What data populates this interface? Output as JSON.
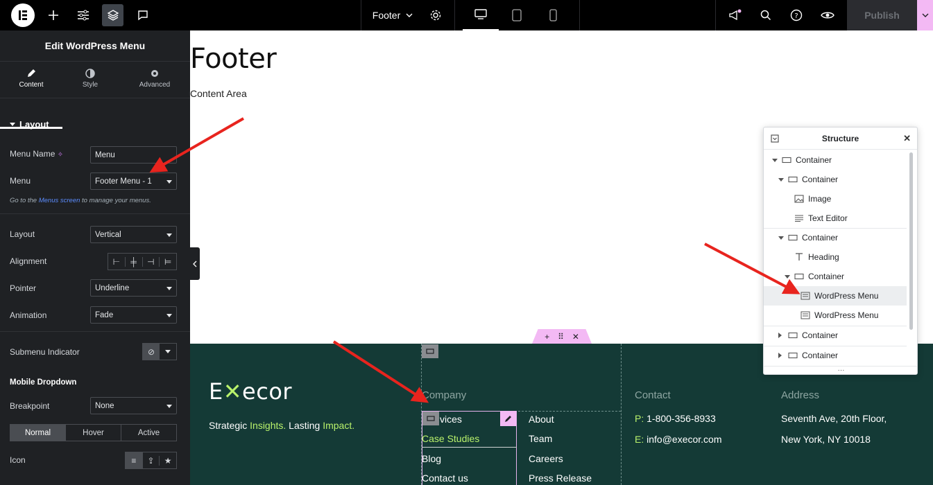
{
  "topbar": {
    "page_name": "Footer",
    "publish_label": "Publish"
  },
  "panel": {
    "title": "Edit WordPress Menu",
    "tabs": [
      {
        "label": "Content",
        "icon": "pencil-icon",
        "active": true
      },
      {
        "label": "Style",
        "icon": "half-circle-icon",
        "active": false
      },
      {
        "label": "Advanced",
        "icon": "gear-icon",
        "active": false
      }
    ],
    "section_layout": "Layout",
    "menu_name_label": "Menu Name",
    "menu_name_value": "Menu",
    "menu_label": "Menu",
    "menu_value": "Footer Menu - 1",
    "hint_prefix": "Go to the",
    "hint_link": "Menus screen",
    "hint_suffix": "to manage your menus.",
    "layout_label": "Layout",
    "layout_value": "Vertical",
    "alignment_label": "Alignment",
    "pointer_label": "Pointer",
    "pointer_value": "Underline",
    "animation_label": "Animation",
    "animation_value": "Fade",
    "submenu_label": "Submenu Indicator",
    "mobile_heading": "Mobile Dropdown",
    "breakpoint_label": "Breakpoint",
    "breakpoint_value": "None",
    "state_tabs": [
      "Normal",
      "Hover",
      "Active"
    ],
    "icon_label": "Icon"
  },
  "canvas": {
    "title": "Footer",
    "subtitle": "Content Area"
  },
  "footer": {
    "logo_text_a": "E",
    "logo_text_b": "ecor",
    "tagline_a": "Strategic ",
    "tagline_b": "Insights.",
    "tagline_c": " Lasting ",
    "tagline_d": "Impact.",
    "company_heading": "Company",
    "menu1": [
      "vices",
      "Case Studies",
      "Blog",
      "Contact us"
    ],
    "menu2": [
      "About",
      "Team",
      "Careers",
      "Press Release"
    ],
    "contact_heading": "Contact",
    "phone_prefix": "P:",
    "phone": "1-800-356-8933",
    "email_prefix": "E:",
    "email": "info@execor.com",
    "address_heading": "Address",
    "address_line1": "Seventh Ave, 20th Floor,",
    "address_line2": "New York, NY 10018",
    "accent_color": "#b9f26b",
    "bg_color": "#143a36"
  },
  "structure": {
    "title": "Structure",
    "items": [
      {
        "label": "Container",
        "level": 0,
        "expanded": true
      },
      {
        "label": "Container",
        "level": 1,
        "expanded": true
      },
      {
        "label": "Image",
        "level": 2
      },
      {
        "label": "Text Editor",
        "level": 2
      },
      {
        "label": "Container",
        "level": 1,
        "expanded": true
      },
      {
        "label": "Heading",
        "level": 2
      },
      {
        "label": "Container",
        "level": 2,
        "expanded": true
      },
      {
        "label": "WordPress Menu",
        "level": 3,
        "selected": true
      },
      {
        "label": "WordPress Menu",
        "level": 3
      },
      {
        "label": "Container",
        "level": 1,
        "expanded": false
      },
      {
        "label": "Container",
        "level": 1,
        "expanded": false
      }
    ]
  }
}
